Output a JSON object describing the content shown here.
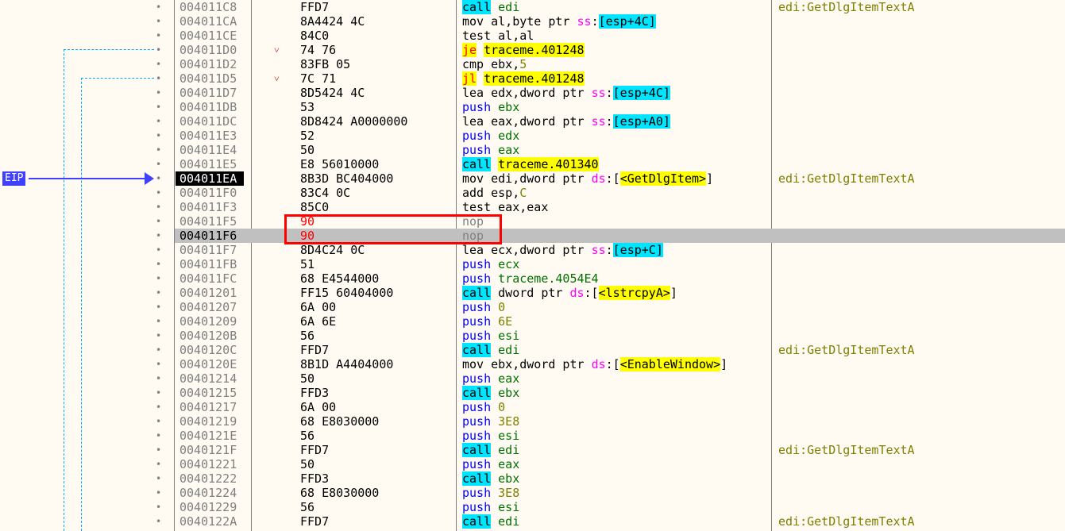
{
  "eip_label": "EIP",
  "rows": [
    {
      "addr": "004011C8",
      "bytes": "FFD7",
      "dis": [
        {
          "t": "call",
          "c": "hl-call"
        },
        {
          "t": " edi",
          "c": "reg"
        }
      ],
      "comment": "edi:GetDlgItemTextA"
    },
    {
      "addr": "004011CA",
      "bytes": "8A4424 4C",
      "dis": [
        {
          "t": "mov al,byte ptr ",
          "c": ""
        },
        {
          "t": "ss",
          "c": "seg"
        },
        {
          "t": ":",
          "c": ""
        },
        {
          "t": "[esp+4C]",
          "c": "brk"
        }
      ],
      "comment": ""
    },
    {
      "addr": "004011CE",
      "bytes": "84C0",
      "dis": [
        {
          "t": "test al,al",
          "c": ""
        }
      ],
      "comment": ""
    },
    {
      "addr": "004011D0",
      "bytes": "74 76",
      "arrow": "˅",
      "dis": [
        {
          "t": "je",
          "c": "hl-jmp"
        },
        {
          "t": " ",
          "c": ""
        },
        {
          "t": "traceme.401248",
          "c": "hl-tgt"
        }
      ],
      "comment": ""
    },
    {
      "addr": "004011D2",
      "bytes": "83FB 05",
      "dis": [
        {
          "t": "cmp ebx,",
          "c": ""
        },
        {
          "t": "5",
          "c": "num"
        }
      ],
      "comment": ""
    },
    {
      "addr": "004011D5",
      "bytes": "7C 71",
      "arrow": "˅",
      "dis": [
        {
          "t": "jl",
          "c": "hl-jmp"
        },
        {
          "t": " ",
          "c": ""
        },
        {
          "t": "traceme.401248",
          "c": "hl-tgt"
        }
      ],
      "comment": ""
    },
    {
      "addr": "004011D7",
      "bytes": "8D5424 4C",
      "dis": [
        {
          "t": "lea edx,dword ptr ",
          "c": ""
        },
        {
          "t": "ss",
          "c": "seg"
        },
        {
          "t": ":",
          "c": ""
        },
        {
          "t": "[esp+4C]",
          "c": "brk"
        }
      ],
      "comment": ""
    },
    {
      "addr": "004011DB",
      "bytes": "53",
      "dis": [
        {
          "t": "push",
          "c": "kw-push"
        },
        {
          "t": " ebx",
          "c": "reg"
        }
      ],
      "comment": ""
    },
    {
      "addr": "004011DC",
      "bytes": "8D8424 A0000000",
      "dis": [
        {
          "t": "lea eax,dword ptr ",
          "c": ""
        },
        {
          "t": "ss",
          "c": "seg"
        },
        {
          "t": ":",
          "c": ""
        },
        {
          "t": "[esp+A0]",
          "c": "brk"
        }
      ],
      "comment": ""
    },
    {
      "addr": "004011E3",
      "bytes": "52",
      "dis": [
        {
          "t": "push",
          "c": "kw-push"
        },
        {
          "t": " edx",
          "c": "reg"
        }
      ],
      "comment": ""
    },
    {
      "addr": "004011E4",
      "bytes": "50",
      "dis": [
        {
          "t": "push",
          "c": "kw-push"
        },
        {
          "t": " eax",
          "c": "reg"
        }
      ],
      "comment": ""
    },
    {
      "addr": "004011E5",
      "bytes": "E8 56010000",
      "dis": [
        {
          "t": "call",
          "c": "hl-call"
        },
        {
          "t": " ",
          "c": ""
        },
        {
          "t": "traceme.401340",
          "c": "hl-tgt"
        }
      ],
      "comment": ""
    },
    {
      "addr": "004011EA",
      "bytes": "8B3D BC404000",
      "eip": true,
      "dis": [
        {
          "t": "mov edi,dword ptr ",
          "c": ""
        },
        {
          "t": "ds",
          "c": "seg"
        },
        {
          "t": ":[",
          "c": ""
        },
        {
          "t": "<GetDlgItem>",
          "c": "hl-tgt"
        },
        {
          "t": "]",
          "c": ""
        }
      ],
      "comment": "edi:GetDlgItemTextA"
    },
    {
      "addr": "004011F0",
      "bytes": "83C4 0C",
      "dis": [
        {
          "t": "add esp,",
          "c": ""
        },
        {
          "t": "C",
          "c": "num"
        }
      ],
      "comment": ""
    },
    {
      "addr": "004011F3",
      "bytes": "85C0",
      "dis": [
        {
          "t": "test eax,eax",
          "c": ""
        }
      ],
      "comment": ""
    },
    {
      "addr": "004011F5",
      "bytes": "90",
      "patched": true,
      "dis": [
        {
          "t": "nop",
          "c": "grey"
        }
      ],
      "comment": ""
    },
    {
      "addr": "004011F6",
      "bytes": "90",
      "patched": true,
      "selected": true,
      "dis": [
        {
          "t": "nop",
          "c": "grey"
        }
      ],
      "comment": ""
    },
    {
      "addr": "004011F7",
      "bytes": "8D4C24 0C",
      "dis": [
        {
          "t": "lea ecx,dword ptr ",
          "c": ""
        },
        {
          "t": "ss",
          "c": "seg"
        },
        {
          "t": ":",
          "c": ""
        },
        {
          "t": "[esp+C]",
          "c": "brk"
        }
      ],
      "comment": ""
    },
    {
      "addr": "004011FB",
      "bytes": "51",
      "dis": [
        {
          "t": "push",
          "c": "kw-push"
        },
        {
          "t": " ecx",
          "c": "reg"
        }
      ],
      "comment": ""
    },
    {
      "addr": "004011FC",
      "bytes": "68 E4544000",
      "dis": [
        {
          "t": "push",
          "c": "kw-push"
        },
        {
          "t": " traceme.4054E4",
          "c": "reg"
        }
      ],
      "comment": ""
    },
    {
      "addr": "00401201",
      "bytes": "FF15 60404000",
      "dis": [
        {
          "t": "call",
          "c": "hl-call"
        },
        {
          "t": " dword ptr ",
          "c": ""
        },
        {
          "t": "ds",
          "c": "seg"
        },
        {
          "t": ":[",
          "c": ""
        },
        {
          "t": "<lstrcpyA>",
          "c": "hl-tgt"
        },
        {
          "t": "]",
          "c": ""
        }
      ],
      "comment": ""
    },
    {
      "addr": "00401207",
      "bytes": "6A 00",
      "dis": [
        {
          "t": "push",
          "c": "kw-push"
        },
        {
          "t": " ",
          "c": ""
        },
        {
          "t": "0",
          "c": "num"
        }
      ],
      "comment": ""
    },
    {
      "addr": "00401209",
      "bytes": "6A 6E",
      "dis": [
        {
          "t": "push",
          "c": "kw-push"
        },
        {
          "t": " ",
          "c": ""
        },
        {
          "t": "6E",
          "c": "num"
        }
      ],
      "comment": ""
    },
    {
      "addr": "0040120B",
      "bytes": "56",
      "dis": [
        {
          "t": "push",
          "c": "kw-push"
        },
        {
          "t": " esi",
          "c": "reg"
        }
      ],
      "comment": ""
    },
    {
      "addr": "0040120C",
      "bytes": "FFD7",
      "dis": [
        {
          "t": "call",
          "c": "hl-call"
        },
        {
          "t": " edi",
          "c": "reg"
        }
      ],
      "comment": "edi:GetDlgItemTextA"
    },
    {
      "addr": "0040120E",
      "bytes": "8B1D A4404000",
      "dis": [
        {
          "t": "mov ebx,dword ptr ",
          "c": ""
        },
        {
          "t": "ds",
          "c": "seg"
        },
        {
          "t": ":[",
          "c": ""
        },
        {
          "t": "<EnableWindow>",
          "c": "hl-tgt"
        },
        {
          "t": "]",
          "c": ""
        }
      ],
      "comment": ""
    },
    {
      "addr": "00401214",
      "bytes": "50",
      "dis": [
        {
          "t": "push",
          "c": "kw-push"
        },
        {
          "t": " eax",
          "c": "reg"
        }
      ],
      "comment": ""
    },
    {
      "addr": "00401215",
      "bytes": "FFD3",
      "dis": [
        {
          "t": "call",
          "c": "hl-call"
        },
        {
          "t": " ebx",
          "c": "reg"
        }
      ],
      "comment": ""
    },
    {
      "addr": "00401217",
      "bytes": "6A 00",
      "dis": [
        {
          "t": "push",
          "c": "kw-push"
        },
        {
          "t": " ",
          "c": ""
        },
        {
          "t": "0",
          "c": "num"
        }
      ],
      "comment": ""
    },
    {
      "addr": "00401219",
      "bytes": "68 E8030000",
      "dis": [
        {
          "t": "push",
          "c": "kw-push"
        },
        {
          "t": " ",
          "c": ""
        },
        {
          "t": "3E8",
          "c": "num"
        }
      ],
      "comment": ""
    },
    {
      "addr": "0040121E",
      "bytes": "56",
      "dis": [
        {
          "t": "push",
          "c": "kw-push"
        },
        {
          "t": " esi",
          "c": "reg"
        }
      ],
      "comment": ""
    },
    {
      "addr": "0040121F",
      "bytes": "FFD7",
      "dis": [
        {
          "t": "call",
          "c": "hl-call"
        },
        {
          "t": " edi",
          "c": "reg"
        }
      ],
      "comment": "edi:GetDlgItemTextA"
    },
    {
      "addr": "00401221",
      "bytes": "50",
      "dis": [
        {
          "t": "push",
          "c": "kw-push"
        },
        {
          "t": " eax",
          "c": "reg"
        }
      ],
      "comment": ""
    },
    {
      "addr": "00401222",
      "bytes": "FFD3",
      "dis": [
        {
          "t": "call",
          "c": "hl-call"
        },
        {
          "t": " ebx",
          "c": "reg"
        }
      ],
      "comment": ""
    },
    {
      "addr": "00401224",
      "bytes": "68 E8030000",
      "dis": [
        {
          "t": "push",
          "c": "kw-push"
        },
        {
          "t": " ",
          "c": ""
        },
        {
          "t": "3E8",
          "c": "num"
        }
      ],
      "comment": ""
    },
    {
      "addr": "00401229",
      "bytes": "56",
      "dis": [
        {
          "t": "push",
          "c": "kw-push"
        },
        {
          "t": " esi",
          "c": "reg"
        }
      ],
      "comment": ""
    },
    {
      "addr": "0040122A",
      "bytes": "FFD7",
      "dis": [
        {
          "t": "call",
          "c": "hl-call"
        },
        {
          "t": " edi",
          "c": "reg"
        }
      ],
      "comment": "edi:GetDlgItemTextA"
    }
  ]
}
